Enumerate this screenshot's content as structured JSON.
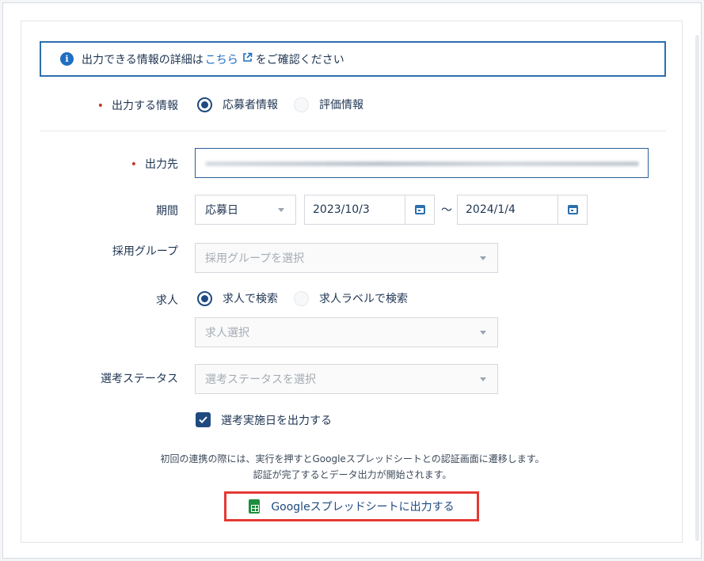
{
  "info": {
    "icon": "info-icon",
    "text_before": "出力できる情報の詳細は",
    "link": "こちら",
    "link_icon": "external-link-icon",
    "text_after": "をご確認ください"
  },
  "output_info": {
    "label": "出力する情報",
    "options": [
      {
        "label": "応募者情報",
        "selected": true
      },
      {
        "label": "評価情報",
        "selected": false
      }
    ]
  },
  "destination": {
    "label": "出力先",
    "value": ""
  },
  "period": {
    "label": "期間",
    "type": "応募日",
    "start": "2023/10/3",
    "separator": "～",
    "end": "2024/1/4"
  },
  "group": {
    "label": "採用グループ",
    "placeholder": "採用グループを選択"
  },
  "job": {
    "label": "求人",
    "options": [
      {
        "label": "求人で検索",
        "selected": true
      },
      {
        "label": "求人ラベルで検索",
        "selected": false
      }
    ],
    "select_placeholder": "求人選択"
  },
  "status": {
    "label": "選考ステータス",
    "placeholder": "選考ステータスを選択"
  },
  "checkbox": {
    "label": "選考実施日を出力する",
    "checked": true
  },
  "note": {
    "line1": "初回の連携の際には、実行を押すとGoogleスプレッドシートとの認証画面に遷移します。",
    "line2": "認証が完了するとデータ出力が開始されます。"
  },
  "export_button": {
    "label": "Googleスプレッドシートに出力する",
    "icon": "google-sheets-icon"
  },
  "colors": {
    "accent": "#1f4a80",
    "link": "#1f6fc0",
    "required": "#c0392b",
    "highlight": "#e53935",
    "sheets": "#1e8e3e"
  }
}
